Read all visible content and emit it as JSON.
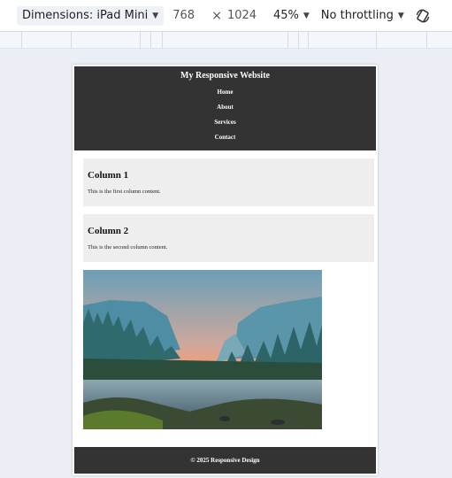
{
  "devtools": {
    "dimensions_label": "Dimensions: iPad Mini",
    "width": "768",
    "times": "×",
    "height": "1024",
    "zoom": "45%",
    "throttling": "No throttling"
  },
  "site": {
    "title": "My Responsive Website",
    "nav": [
      "Home",
      "About",
      "Services",
      "Contact"
    ],
    "columns": [
      {
        "heading": "Column 1",
        "text": "This is the first column content."
      },
      {
        "heading": "Column 2",
        "text": "This is the second column content."
      }
    ],
    "footer": "© 2025 Responsive Design"
  },
  "colors": {
    "header_bg": "#333333",
    "column_bg": "#eeeeee",
    "page_bg": "#ebeef5"
  },
  "icons": [
    "chevron-down-icon",
    "rotate-icon"
  ]
}
